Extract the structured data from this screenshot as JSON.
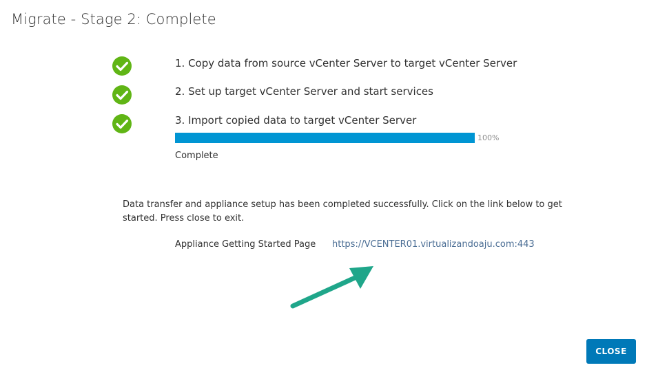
{
  "dialog": {
    "title": "Migrate - Stage 2: Complete"
  },
  "steps": [
    {
      "label": "1. Copy data from source vCenter Server to target vCenter Server",
      "status_icon": "check-circle-icon"
    },
    {
      "label": "2. Set up target vCenter Server and start services",
      "status_icon": "check-circle-icon"
    },
    {
      "label": "3. Import copied data to target vCenter Server",
      "status_icon": "check-circle-icon"
    }
  ],
  "progress": {
    "value": 100,
    "percent_label": "100%",
    "status_text": "Complete"
  },
  "message": "Data transfer and appliance setup has been completed successfully. Click on the link below to get started. Press close to exit.",
  "getting_started": {
    "label": "Appliance Getting Started Page",
    "url": "https://VCENTER01.virtualizandoaju.com:443"
  },
  "footer": {
    "close_label": "CLOSE"
  },
  "colors": {
    "success_green": "#60b515",
    "progress_blue": "#0095d3",
    "button_blue": "#0079b8",
    "link_color": "#4a6d94",
    "annotation_arrow": "#1fa68a"
  }
}
